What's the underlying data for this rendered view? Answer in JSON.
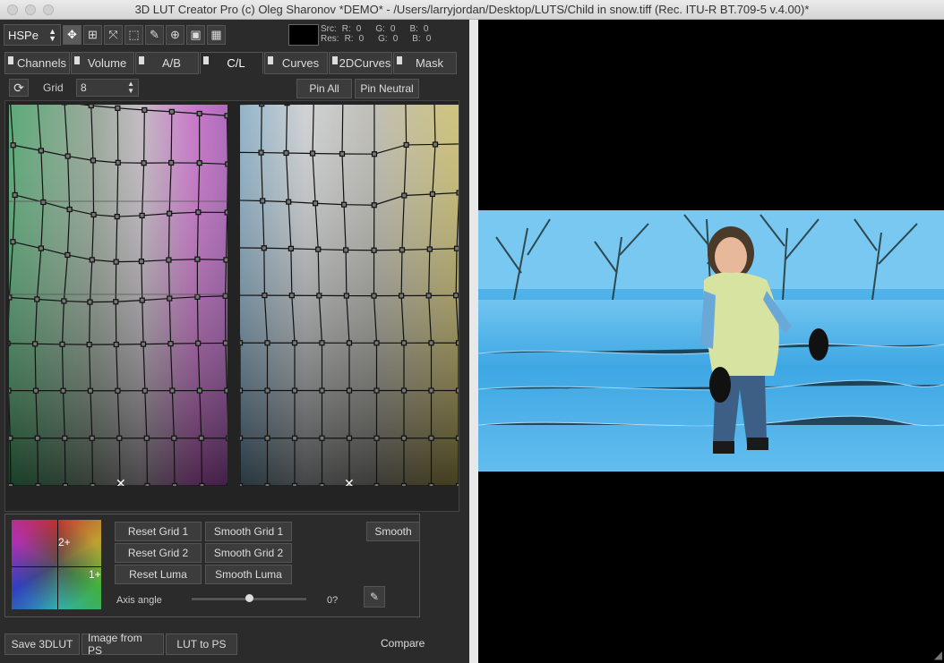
{
  "window": {
    "title": "3D LUT Creator Pro (c) Oleg Sharonov *DEMO* - /Users/larryjordan/Desktop/LUTS/Child in snow.tiff (Rec. ITU-R BT.709-5 v.4.00)*"
  },
  "toolbar": {
    "mode_select": "HSPe",
    "tools": [
      "move-icon",
      "grid-move-icon",
      "scale-icon",
      "select-rect-icon",
      "eyedropper-icon",
      "zoom-icon",
      "fit-icon",
      "layout-icon"
    ]
  },
  "readout": {
    "src_label": "Src:",
    "res_label": "Res:",
    "src": {
      "R": "R:",
      "R_val": "0",
      "G": "G:",
      "G_val": "0",
      "B": "B:",
      "B_val": "0"
    },
    "res": {
      "R": "R:",
      "R_val": "0",
      "G": "G:",
      "G_val": "0",
      "B": "B:",
      "B_val": "0"
    }
  },
  "tabs": [
    {
      "label": "Channels"
    },
    {
      "label": "Volume"
    },
    {
      "label": "A/B"
    },
    {
      "label": "C/L",
      "active": true
    },
    {
      "label": "Curves"
    },
    {
      "label": "2DCurves"
    },
    {
      "label": "Mask"
    }
  ],
  "gridbar": {
    "grid_label": "Grid",
    "grid_value": "8",
    "pin_all": "Pin All",
    "pin_neutral": "Pin Neutral"
  },
  "panel": {
    "reset_grid1": "Reset Grid 1",
    "smooth_grid1": "Smooth Grid 1",
    "reset_grid2": "Reset Grid 2",
    "smooth_grid2": "Smooth Grid 2",
    "reset_luma": "Reset Luma",
    "smooth_luma": "Smooth Luma",
    "smooth": "Smooth",
    "axis_angle_label": "Axis angle",
    "axis_angle_value": "0?",
    "wheel_label_2": "2+",
    "wheel_label_1": "1+",
    "axis_angle_fraction": 0.5
  },
  "footer": {
    "save_3dlut": "Save 3DLUT",
    "image_from_ps": "Image from PS",
    "lut_to_ps": "LUT to PS",
    "compare": "Compare"
  },
  "colors": {
    "panel_bg": "#2b2b2b",
    "button_bg": "#3c3c3c",
    "snow_blue": "#4aaee8",
    "jacket": "#d7e3a0"
  }
}
